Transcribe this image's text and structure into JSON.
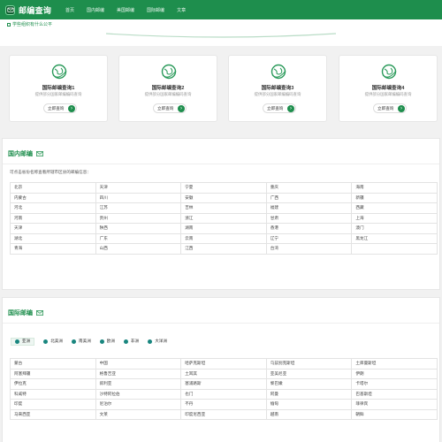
{
  "header": {
    "logo_text": "邮编查询",
    "nav": [
      "首页",
      "国内邮编",
      "美国邮编",
      "国际邮编",
      "文章"
    ]
  },
  "promo": {
    "text": "学些组织有什么公平"
  },
  "cards": [
    {
      "title": "国际邮编查询1",
      "desc": "提供部分国家邮编编码查询",
      "button": "立即查询",
      "arrow": "›"
    },
    {
      "title": "国际邮编查询2",
      "desc": "提供部分国家邮编编码查询",
      "button": "立即查询",
      "arrow": "›"
    },
    {
      "title": "国际邮编查询3",
      "desc": "提供部分国家邮编编码查询",
      "button": "立即查询",
      "arrow": "›"
    },
    {
      "title": "国际邮编查询4",
      "desc": "提供部分国家邮编编码查询",
      "button": "立即查询",
      "arrow": "›"
    }
  ],
  "domestic": {
    "title": "国内邮编",
    "hint": "可点击省份名称查看所辖市区县的邮编信息：",
    "rows": [
      [
        "北京",
        "天津",
        "宁夏",
        "重庆",
        "海南"
      ],
      [
        "内蒙古",
        "四川",
        "安徽",
        "广西",
        "新疆"
      ],
      [
        "河北",
        "江苏",
        "吉林",
        "福建",
        "西藏"
      ],
      [
        "河南",
        "贵州",
        "浙江",
        "甘肃",
        "上海"
      ],
      [
        "天津",
        "陕西",
        "湖南",
        "香港",
        "澳门"
      ],
      [
        "湖北",
        "广东",
        "云南",
        "辽宁",
        "黑龙江"
      ],
      [
        "青海",
        "山西",
        "江西",
        "台湾",
        ""
      ]
    ]
  },
  "international": {
    "title": "国际邮编",
    "tabs": [
      "亚洲",
      "北美洲",
      "南美洲",
      "欧洲",
      "非洲",
      "大洋洲"
    ],
    "rows": [
      [
        "蒙古",
        "中国",
        "哈萨克斯坦",
        "乌兹别克斯坦",
        "土库曼斯坦"
      ],
      [
        "阿塞拜疆",
        "格鲁吉亚",
        "土耳其",
        "亚美尼亚",
        "伊朗"
      ],
      [
        "伊拉克",
        "叙利亚",
        "塞浦路斯",
        "黎巴嫩",
        "卡塔尔"
      ],
      [
        "科威特",
        "沙特阿拉伯",
        "也门",
        "阿曼",
        "巴基斯坦"
      ],
      [
        "印度",
        "尼泊尔",
        "不丹",
        "缅甸",
        "菲律宾"
      ],
      [
        "马来西亚",
        "文莱",
        "印度尼西亚",
        "越南",
        "朝鲜"
      ]
    ]
  },
  "colors": {
    "brand": "#1e8e4d",
    "tab_dot": "#19867f"
  }
}
